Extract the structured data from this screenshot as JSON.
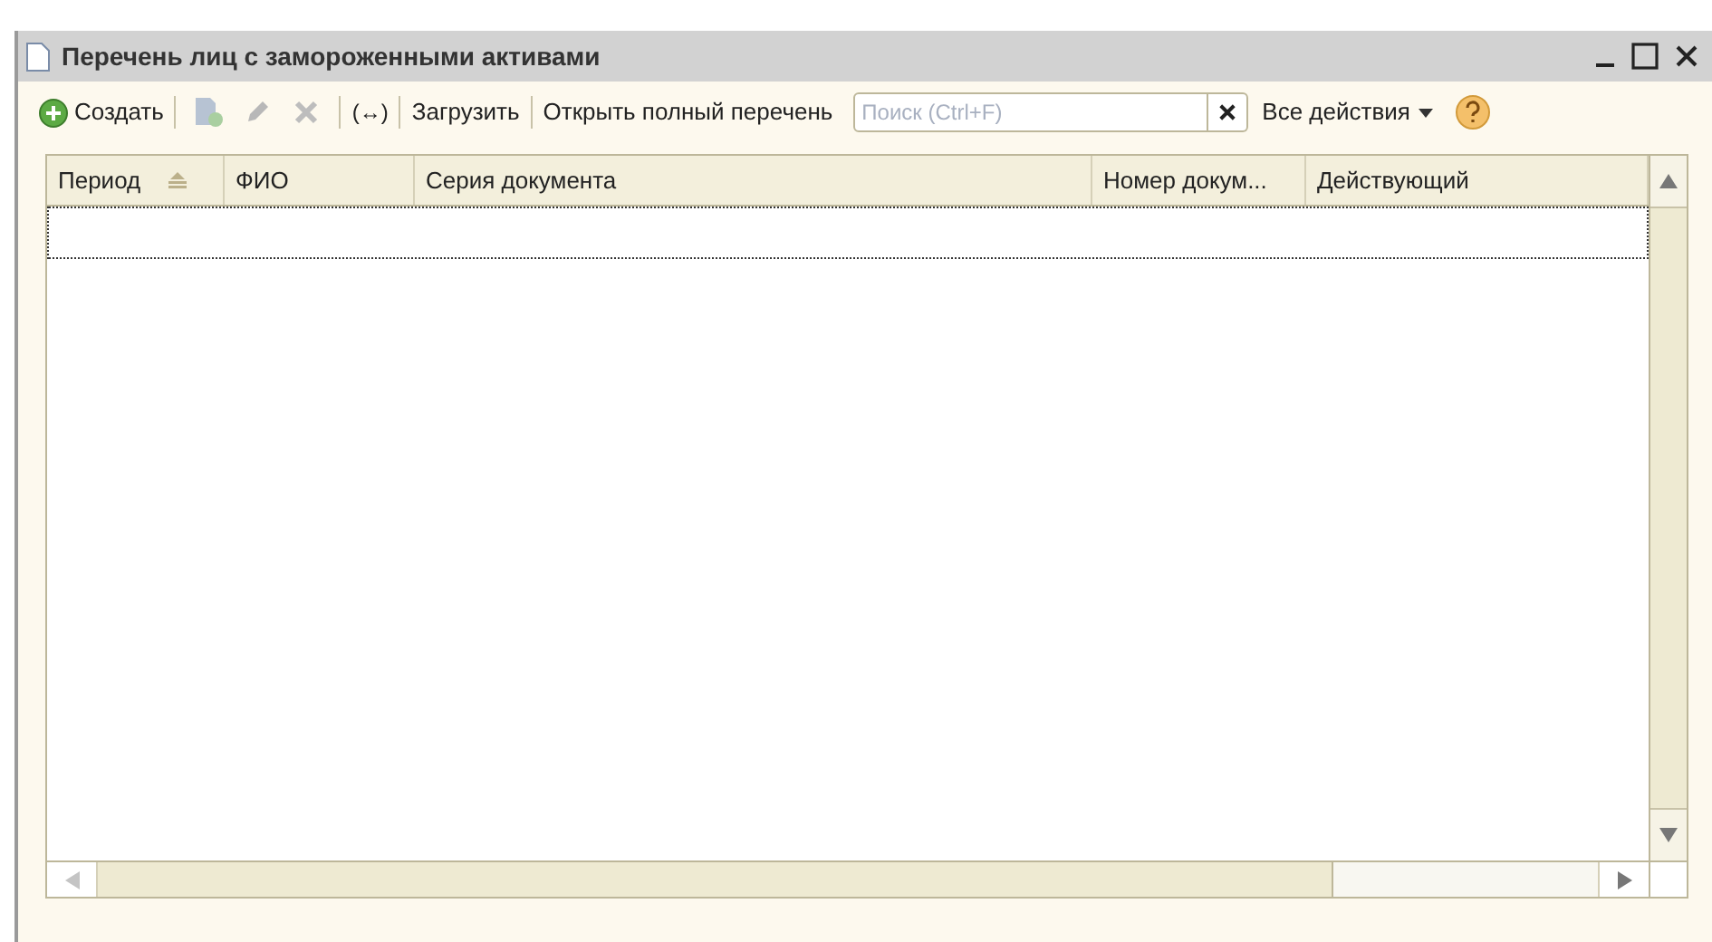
{
  "window": {
    "title": "Перечень лиц с замороженными активами"
  },
  "toolbar": {
    "create": "Создать",
    "toggle": "(↔)",
    "load": "Загрузить",
    "open_full": "Открыть полный перечень",
    "search": {
      "placeholder": "Поиск (Ctrl+F)"
    },
    "all_actions": "Все действия"
  },
  "table": {
    "columns": [
      {
        "label": "Период",
        "sorted": true
      },
      {
        "label": "ФИО",
        "sorted": false
      },
      {
        "label": "Серия документа",
        "sorted": false
      },
      {
        "label": "Номер докум...",
        "sorted": false
      },
      {
        "label": "Действующий",
        "sorted": false
      }
    ]
  }
}
